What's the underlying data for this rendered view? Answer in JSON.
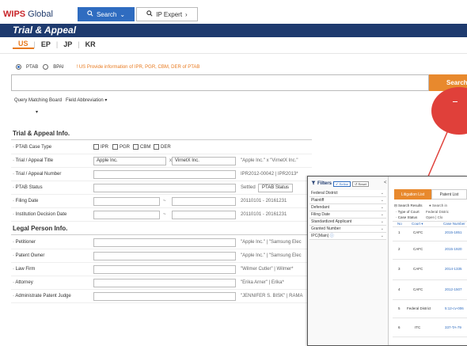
{
  "header": {
    "logo_brand": "WIPS",
    "logo_suffix": " Global",
    "search_tab": "Search",
    "ip_expert_tab": "IP Expert"
  },
  "page_title": "Trial & Appeal",
  "country_tabs": [
    "US",
    "EP",
    "JP",
    "KR"
  ],
  "search": {
    "radio_ptab": "PTAB",
    "radio_bpai": "BPAI",
    "info": "US Provide information of IPR, PGR, CBM, DER of PTAB",
    "button": "Search",
    "query_matching_board": "Query Matching Board",
    "field_abbreviation": "Field Abbreviation"
  },
  "trial_section": {
    "title": "Trial & Appeal Info.",
    "case_type_label": "PTAB Case Type",
    "case_types": [
      "IPR",
      "PGR",
      "CBM",
      "DER"
    ],
    "title_label": "Trial / Appeal Title",
    "title_value_1": "Apple Inc.",
    "title_x": "x",
    "title_value_2": "VirnetX Inc.",
    "title_hint": "\"Apple Inc.\" x \"VirnetX Inc.\"",
    "number_label": "Trial / Appeal Number",
    "number_hint": "IPR2012-00042  |  IPR2013*",
    "status_label": "PTAB Status",
    "status_hint": "Settled",
    "status_button": "PTAB Status",
    "filing_label": "Filing Date",
    "filing_hint": "20110101 - 20161231",
    "institution_label": "Institution Decision Date",
    "institution_hint": "20110101 - 20161231",
    "range_dash": "~"
  },
  "legal_section": {
    "title": "Legal Person Info.",
    "rows": [
      {
        "label": "Petitioner",
        "hint": "\"Apple Inc.\"  |  \"Samsung Elec"
      },
      {
        "label": "Patent Owner",
        "hint": "\"Apple Inc.\"  |  \"Samsung Elec"
      },
      {
        "label": "Law Firm",
        "hint": "\"Wilmer Cutler\"  |  Wilmer*"
      },
      {
        "label": "Attorney",
        "hint": "\"Erika Arner\"  |  Erika*"
      },
      {
        "label": "Administrate Patent Judge",
        "hint": "\"JENNIFER S. BISK\"  |  RAMA"
      }
    ]
  },
  "filters": {
    "title": "Filters",
    "refine": "Refine",
    "reset": "Reset",
    "collapse": "<",
    "items": [
      "Federal District",
      "Plaintiff",
      "Defendant",
      "Filing Date",
      "Standardized Applicant",
      "Granted Number",
      "IPC(Main)"
    ]
  },
  "results": {
    "tab_active": "Litigation List",
    "tab_inactive": "Patent List",
    "search_results": "Search Results",
    "search_in": "Search in",
    "type_of_court": "Type of Court",
    "type_of_court_value": "Federal Distric",
    "case_status": "Case Status",
    "case_status_value": "Open  |  Clo",
    "columns": [
      "No",
      "Court",
      "Case Number"
    ],
    "rows": [
      {
        "no": "1",
        "court": "CAFC",
        "case": "2015-1851"
      },
      {
        "no": "2",
        "court": "CAFC",
        "case": "2015-1920"
      },
      {
        "no": "3",
        "court": "CAFC",
        "case": "2014-1335"
      },
      {
        "no": "4",
        "court": "CAFC",
        "case": "2012-1507"
      },
      {
        "no": "5",
        "court": "Federal District",
        "case": "5:12-cv-006"
      },
      {
        "no": "6",
        "court": "ITC",
        "case": "337-TA-79"
      }
    ]
  },
  "colors": {
    "brand_red": "#c8252a",
    "navy": "#1e3a6e",
    "accent_orange": "#e8892d",
    "blue": "#2f6cc0",
    "marker_red": "#e0403a"
  }
}
